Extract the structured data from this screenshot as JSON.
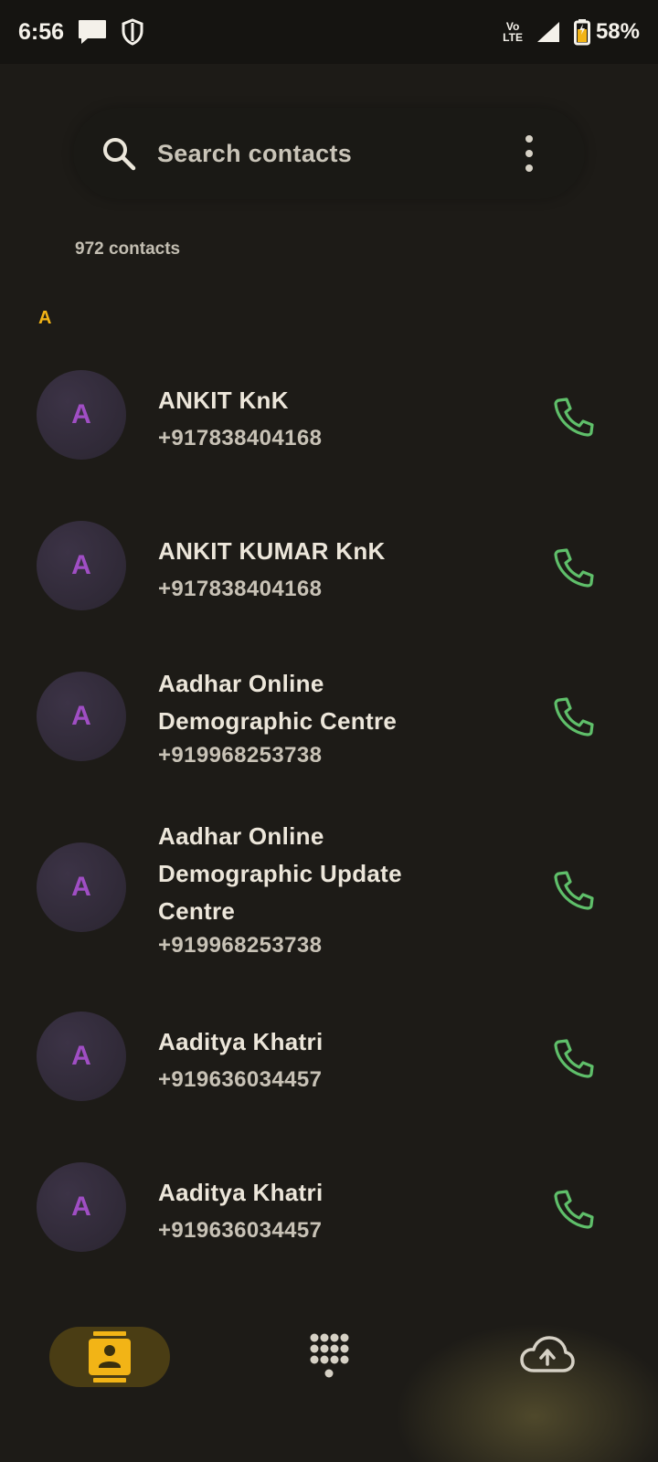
{
  "status_bar": {
    "time": "6:56",
    "network_label_top": "Vo",
    "network_label_bottom": "LTE",
    "battery": "58%"
  },
  "search": {
    "placeholder": "Search contacts"
  },
  "contacts_count": "972 contacts",
  "section_letter": "A",
  "contacts": [
    {
      "initial": "A",
      "name_lines": [
        "ANKIT KnK"
      ],
      "phone": "+917838404168"
    },
    {
      "initial": "A",
      "name_lines": [
        "ANKIT KUMAR KnK"
      ],
      "phone": "+917838404168"
    },
    {
      "initial": "A",
      "name_lines": [
        "Aadhar Online",
        "Demographic Centre"
      ],
      "phone": "+919968253738"
    },
    {
      "initial": "A",
      "name_lines": [
        "Aadhar Online",
        "Demographic Update",
        "Centre"
      ],
      "phone": "+919968253738"
    },
    {
      "initial": "A",
      "name_lines": [
        "Aaditya Khatri"
      ],
      "phone": "+919636034457"
    },
    {
      "initial": "A",
      "name_lines": [
        "Aaditya Khatri"
      ],
      "phone": "+919636034457"
    }
  ],
  "colors": {
    "accent": "#f2b416",
    "call_green": "#5fbf6a",
    "avatar_letter": "#a04ec4"
  },
  "nav": {
    "items": [
      "contacts-icon",
      "dialpad-icon",
      "cloud-upload-icon"
    ],
    "selected": "contacts-icon"
  }
}
